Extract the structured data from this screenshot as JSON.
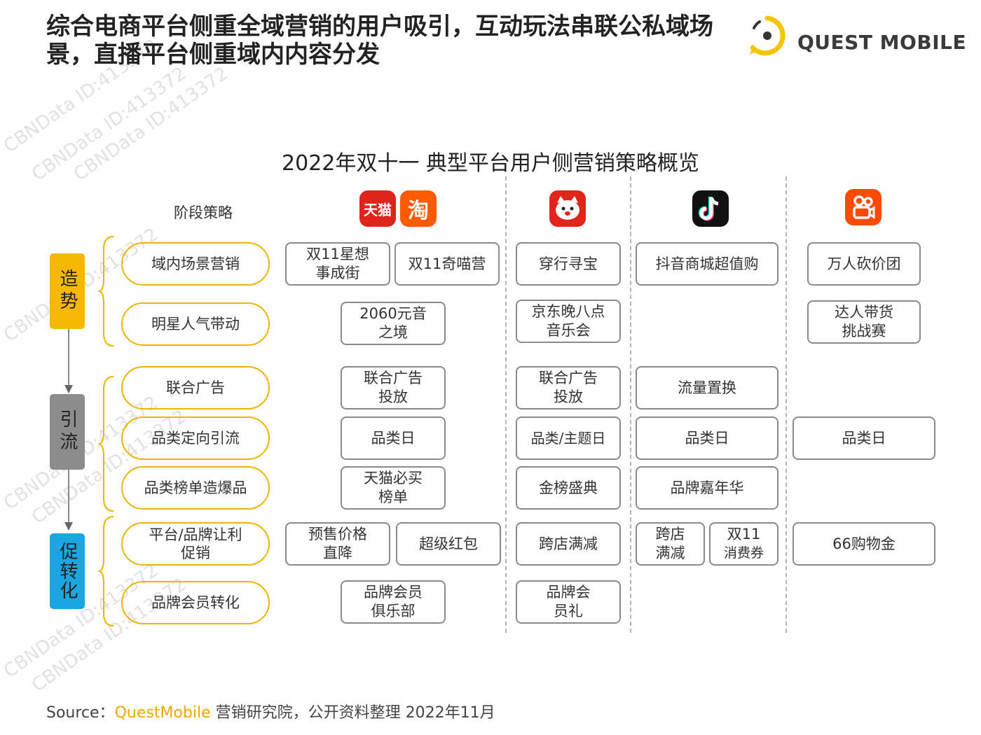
{
  "headline": "综合电商平台侧重全域营销的用户吸引，互动玩法串联公私域场景，直播平台侧重域内内容分发",
  "brand_logo_text": "QUEST MOBILE",
  "subtitle": "2022年双十一 典型平台用户侧营销策略概览",
  "stage_header": "阶段策略",
  "platform_icons": [
    {
      "name": "tmall",
      "label": "天猫",
      "color": "#e0231b"
    },
    {
      "name": "taobao",
      "label": "淘",
      "color": "#ff5a00"
    },
    {
      "name": "jd",
      "label": "JD",
      "color": "#e1251b"
    },
    {
      "name": "douyin",
      "label": "抖音",
      "color": "#111111"
    },
    {
      "name": "kuaishou",
      "label": "快手",
      "color": "#ff4906"
    }
  ],
  "stages": [
    {
      "label": "造势",
      "color": "#f6b900"
    },
    {
      "label": "引流",
      "color": "#8c8c8c"
    },
    {
      "label": "促转化",
      "color": "#1aa6e0"
    }
  ],
  "strategies": [
    "域内场景营销",
    "明星人气带动",
    "联合广告",
    "品类定向引流",
    "品类榜单造爆品",
    "平台/品牌让利促销",
    "品牌会员转化"
  ],
  "cells": {
    "tm_1a": "双11星想事成街",
    "tm_1b": "双11奇喵营",
    "tm_2": "2060元音之境",
    "tm_3": "联合广告投放",
    "tm_4": "品类日",
    "tm_5": "天猫必买榜单",
    "tm_6a": "预售价格直降",
    "tm_6b": "超级红包",
    "tm_7": "品牌会员俱乐部",
    "jd_1": "穿行寻宝",
    "jd_2": "京东晚八点音乐会",
    "jd_3": "联合广告投放",
    "jd_4": "品类/主题日",
    "jd_5": "金榜盛典",
    "jd_6": "跨店满减",
    "jd_7": "品牌会员礼",
    "dy_1": "抖音商城超值购",
    "dy_3": "流量置换",
    "dy_4": "品类日",
    "dy_5": "品牌嘉年华",
    "dy_6a": "跨店满减",
    "dy_6b_main": "双11",
    "dy_6b_sub": "消费券",
    "ks_1": "万人砍价团",
    "ks_2": "达人带货挑战赛",
    "ks_4": "品类日",
    "ks_6": "66购物金"
  },
  "source": {
    "prefix": "Source：",
    "brand": "QuestMobile",
    "suffix": " 营销研究院，公开资料整理 2022年11月"
  },
  "watermark": "CBNData ID:413372",
  "accent_color": "#f0b400"
}
